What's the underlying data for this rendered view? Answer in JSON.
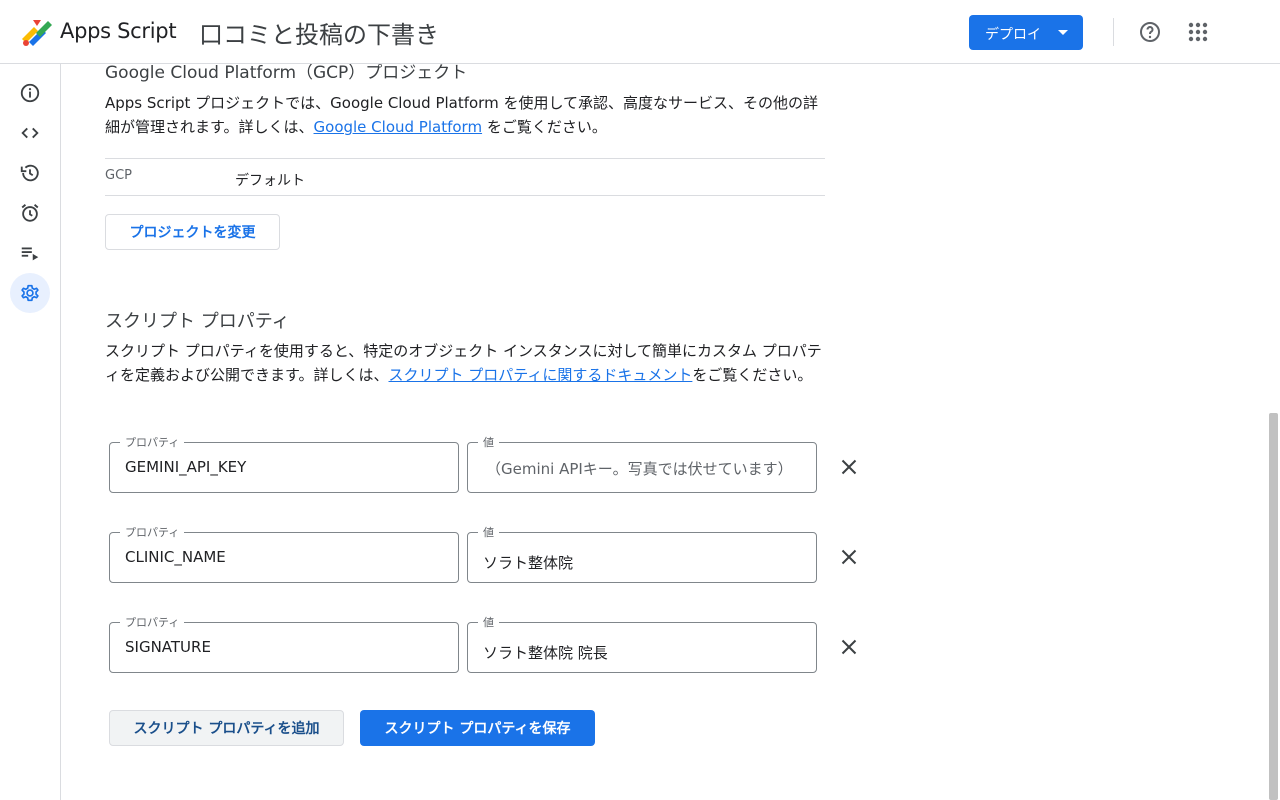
{
  "header": {
    "app_name": "Apps Script",
    "project_title": "口コミと投稿の下書き",
    "deploy_label": "デプロイ",
    "icons": [
      "apps-script-logo",
      "help-icon",
      "apps-grid-icon"
    ]
  },
  "sidebar": {
    "items": [
      {
        "name": "overview",
        "icon": "info-icon",
        "active": false
      },
      {
        "name": "editor",
        "icon": "code-icon",
        "active": false
      },
      {
        "name": "executions-history",
        "icon": "history-icon",
        "active": false
      },
      {
        "name": "triggers",
        "icon": "alarm-icon",
        "active": false
      },
      {
        "name": "executions",
        "icon": "playlist-icon",
        "active": false
      },
      {
        "name": "project-settings",
        "icon": "gear-icon",
        "active": true
      }
    ],
    "accent": "#1a73e8"
  },
  "gcp": {
    "heading": "Google Cloud Platform（GCP）プロジェクト",
    "desc_part1": "Apps Script プロジェクトでは、Google Cloud Platform を使用して承認、高度なサービス、その他の詳細が管理されます。詳しくは、",
    "desc_link": "Google Cloud Platform",
    "desc_part2": " をご覧ください。",
    "row_label": "GCP",
    "row_value": "デフォルト",
    "change_button": "プロジェクトを変更"
  },
  "script_properties": {
    "heading": "スクリプト プロパティ",
    "desc_part1": "スクリプト プロパティを使用すると、特定のオブジェクト インスタンスに対して簡単にカスタム プロパティを定義および公開できます。詳しくは、",
    "desc_link": "スクリプト プロパティに関するドキュメント",
    "desc_part2": "をご覧ください。",
    "property_label": "プロパティ",
    "value_label": "値",
    "rows": [
      {
        "property": "GEMINI_API_KEY",
        "value": "（Gemini APIキー。写真では伏せています）"
      },
      {
        "property": "CLINIC_NAME",
        "value": "ソラト整体院"
      },
      {
        "property": "SIGNATURE",
        "value": "ソラト整体院 院長"
      }
    ],
    "add_button": "スクリプト プロパティを追加",
    "save_button": "スクリプト プロパティを保存"
  }
}
